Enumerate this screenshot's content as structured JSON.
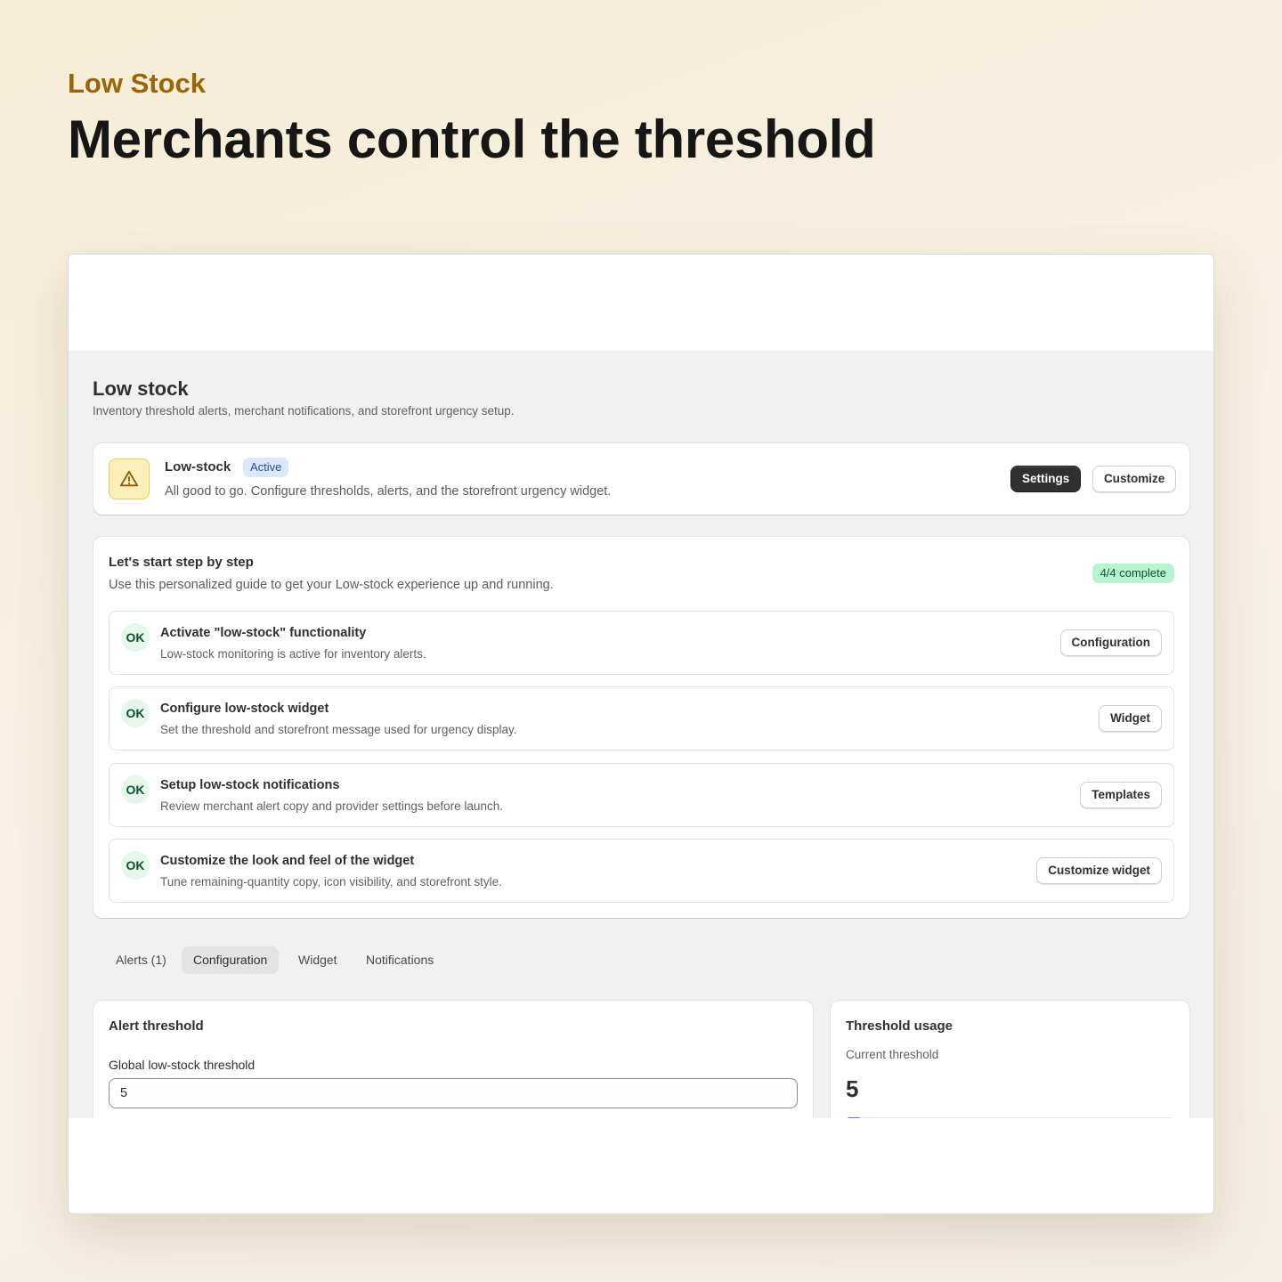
{
  "hero": {
    "eyebrow": "Low Stock",
    "headline": "Merchants control the threshold"
  },
  "page": {
    "title": "Low stock",
    "subtitle": "Inventory threshold alerts, merchant notifications, and storefront urgency setup."
  },
  "status": {
    "icon": "warning-icon",
    "name": "Low-stock",
    "badge": "Active",
    "description": "All good to go. Configure thresholds, alerts, and the storefront urgency widget.",
    "settings_label": "Settings",
    "customize_label": "Customize"
  },
  "guide": {
    "title": "Let's start step by step",
    "subtitle": "Use this personalized guide to get your Low-stock experience up and running.",
    "progress": "4/4 complete",
    "steps": [
      {
        "check": "OK",
        "title": "Activate \"low-stock\" functionality",
        "description": "Low-stock monitoring is active for inventory alerts.",
        "action": "Configuration"
      },
      {
        "check": "OK",
        "title": "Configure low-stock widget",
        "description": "Set the threshold and storefront message used for urgency display.",
        "action": "Widget"
      },
      {
        "check": "OK",
        "title": "Setup low-stock notifications",
        "description": "Review merchant alert copy and provider settings before launch.",
        "action": "Templates"
      },
      {
        "check": "OK",
        "title": "Customize the look and feel of the widget",
        "description": "Tune remaining-quantity copy, icon visibility, and storefront style.",
        "action": "Customize widget"
      }
    ]
  },
  "tabs": [
    {
      "label": "Alerts (1)"
    },
    {
      "label": "Configuration",
      "active": true
    },
    {
      "label": "Widget"
    },
    {
      "label": "Notifications"
    }
  ],
  "threshold": {
    "title": "Alert threshold",
    "field_label": "Global low-stock threshold",
    "field_value": "5"
  },
  "usage": {
    "title": "Threshold usage",
    "label": "Current threshold",
    "value": "5",
    "bar_fill_fraction": 0.05
  },
  "colors": {
    "accent": "#9a6508",
    "active_badge": "#dbe8fb",
    "complete_badge": "#b8f5cf",
    "ok_badge": "#e6f8ec",
    "primary_button": "#303030",
    "usage_bar": "#3b82f6"
  }
}
